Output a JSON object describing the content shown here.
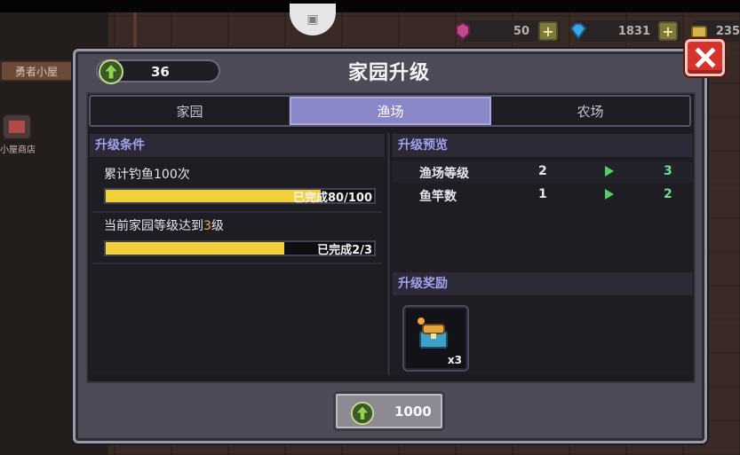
{
  "background": {
    "house_sign": "勇者小屋",
    "shop_label": "小屋商店",
    "resources": [
      {
        "icon": "pink-gem-icon",
        "value": "50",
        "color": "#c04a8a"
      },
      {
        "icon": "blue-diamond-icon",
        "value": "1831",
        "color": "#3aa6e8"
      },
      {
        "icon": "gold-coin-icon",
        "value": "235",
        "color": "#d6b24a"
      }
    ]
  },
  "dialog": {
    "level_icon": "green-up-arrow-icon",
    "level": "36",
    "title": "家园升级",
    "close_icon": "close-x-icon",
    "tabs": [
      {
        "label": "家园",
        "active": false
      },
      {
        "label": "渔场",
        "active": true
      },
      {
        "label": "农场",
        "active": false
      }
    ],
    "conditions": {
      "header": "升级条件",
      "items": [
        {
          "text": "累计钓鱼100次",
          "progress_label": "已完成80/100",
          "progress": 0.8
        },
        {
          "text_prefix": "当前家园等级达到",
          "text_highlight": "3",
          "text_suffix": "级",
          "progress_label": "已完成2/3",
          "progress": 0.667
        }
      ]
    },
    "preview": {
      "header": "升级预览",
      "rows": [
        {
          "name": "渔场等级",
          "from": "2",
          "to": "3"
        },
        {
          "name": "鱼竿数",
          "from": "1",
          "to": "2"
        }
      ]
    },
    "rewards": {
      "header": "升级奖励",
      "items": [
        {
          "icon": "treasure-chest-icon",
          "count": "x3"
        }
      ]
    },
    "upgrade_button": {
      "icon": "green-up-arrow-icon",
      "cost": "1000"
    }
  },
  "colors": {
    "accent_tab": "#8a87c9",
    "progress_fill": "#f1d23b",
    "section_header": "#a3a1f0",
    "close_red": "#d7322b",
    "arrow_green": "#4fd06a"
  }
}
